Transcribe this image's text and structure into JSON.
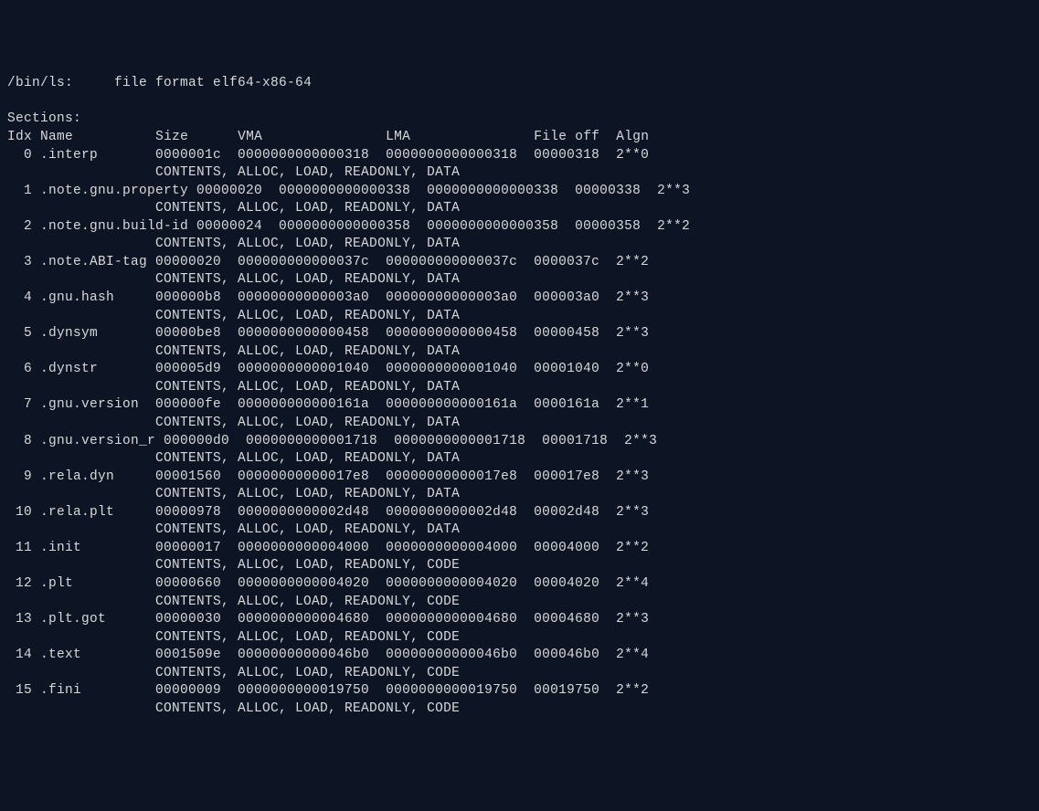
{
  "header": {
    "file": "/bin/ls:",
    "format_label": "file format elf64-x86-64"
  },
  "sections_header": "Sections:",
  "columns": {
    "idx": "Idx",
    "name": "Name",
    "size": "Size",
    "vma": "VMA",
    "lma": "LMA",
    "fileoff": "File off",
    "algn": "Algn"
  },
  "sections": [
    {
      "idx": "0",
      "name": ".interp",
      "size": "0000001c",
      "vma": "0000000000000318",
      "lma": "0000000000000318",
      "fileoff": "00000318",
      "algn": "2**0",
      "flags": "CONTENTS, ALLOC, LOAD, READONLY, DATA"
    },
    {
      "idx": "1",
      "name": ".note.gnu.property",
      "size": "00000020",
      "vma": "0000000000000338",
      "lma": "0000000000000338",
      "fileoff": "00000338",
      "algn": "2**3",
      "flags": "CONTENTS, ALLOC, LOAD, READONLY, DATA"
    },
    {
      "idx": "2",
      "name": ".note.gnu.build-id",
      "size": "00000024",
      "vma": "0000000000000358",
      "lma": "0000000000000358",
      "fileoff": "00000358",
      "algn": "2**2",
      "flags": "CONTENTS, ALLOC, LOAD, READONLY, DATA"
    },
    {
      "idx": "3",
      "name": ".note.ABI-tag",
      "size": "00000020",
      "vma": "000000000000037c",
      "lma": "000000000000037c",
      "fileoff": "0000037c",
      "algn": "2**2",
      "flags": "CONTENTS, ALLOC, LOAD, READONLY, DATA"
    },
    {
      "idx": "4",
      "name": ".gnu.hash",
      "size": "000000b8",
      "vma": "00000000000003a0",
      "lma": "00000000000003a0",
      "fileoff": "000003a0",
      "algn": "2**3",
      "flags": "CONTENTS, ALLOC, LOAD, READONLY, DATA"
    },
    {
      "idx": "5",
      "name": ".dynsym",
      "size": "00000be8",
      "vma": "0000000000000458",
      "lma": "0000000000000458",
      "fileoff": "00000458",
      "algn": "2**3",
      "flags": "CONTENTS, ALLOC, LOAD, READONLY, DATA"
    },
    {
      "idx": "6",
      "name": ".dynstr",
      "size": "000005d9",
      "vma": "0000000000001040",
      "lma": "0000000000001040",
      "fileoff": "00001040",
      "algn": "2**0",
      "flags": "CONTENTS, ALLOC, LOAD, READONLY, DATA"
    },
    {
      "idx": "7",
      "name": ".gnu.version",
      "size": "000000fe",
      "vma": "000000000000161a",
      "lma": "000000000000161a",
      "fileoff": "0000161a",
      "algn": "2**1",
      "flags": "CONTENTS, ALLOC, LOAD, READONLY, DATA"
    },
    {
      "idx": "8",
      "name": ".gnu.version_r",
      "size": "000000d0",
      "vma": "0000000000001718",
      "lma": "0000000000001718",
      "fileoff": "00001718",
      "algn": "2**3",
      "flags": "CONTENTS, ALLOC, LOAD, READONLY, DATA"
    },
    {
      "idx": "9",
      "name": ".rela.dyn",
      "size": "00001560",
      "vma": "00000000000017e8",
      "lma": "00000000000017e8",
      "fileoff": "000017e8",
      "algn": "2**3",
      "flags": "CONTENTS, ALLOC, LOAD, READONLY, DATA"
    },
    {
      "idx": "10",
      "name": ".rela.plt",
      "size": "00000978",
      "vma": "0000000000002d48",
      "lma": "0000000000002d48",
      "fileoff": "00002d48",
      "algn": "2**3",
      "flags": "CONTENTS, ALLOC, LOAD, READONLY, DATA"
    },
    {
      "idx": "11",
      "name": ".init",
      "size": "00000017",
      "vma": "0000000000004000",
      "lma": "0000000000004000",
      "fileoff": "00004000",
      "algn": "2**2",
      "flags": "CONTENTS, ALLOC, LOAD, READONLY, CODE"
    },
    {
      "idx": "12",
      "name": ".plt",
      "size": "00000660",
      "vma": "0000000000004020",
      "lma": "0000000000004020",
      "fileoff": "00004020",
      "algn": "2**4",
      "flags": "CONTENTS, ALLOC, LOAD, READONLY, CODE"
    },
    {
      "idx": "13",
      "name": ".plt.got",
      "size": "00000030",
      "vma": "0000000000004680",
      "lma": "0000000000004680",
      "fileoff": "00004680",
      "algn": "2**3",
      "flags": "CONTENTS, ALLOC, LOAD, READONLY, CODE"
    },
    {
      "idx": "14",
      "name": ".text",
      "size": "0001509e",
      "vma": "00000000000046b0",
      "lma": "00000000000046b0",
      "fileoff": "000046b0",
      "algn": "2**4",
      "flags": "CONTENTS, ALLOC, LOAD, READONLY, CODE"
    },
    {
      "idx": "15",
      "name": ".fini",
      "size": "00000009",
      "vma": "0000000000019750",
      "lma": "0000000000019750",
      "fileoff": "00019750",
      "algn": "2**2",
      "flags": "CONTENTS, ALLOC, LOAD, READONLY, CODE"
    }
  ]
}
